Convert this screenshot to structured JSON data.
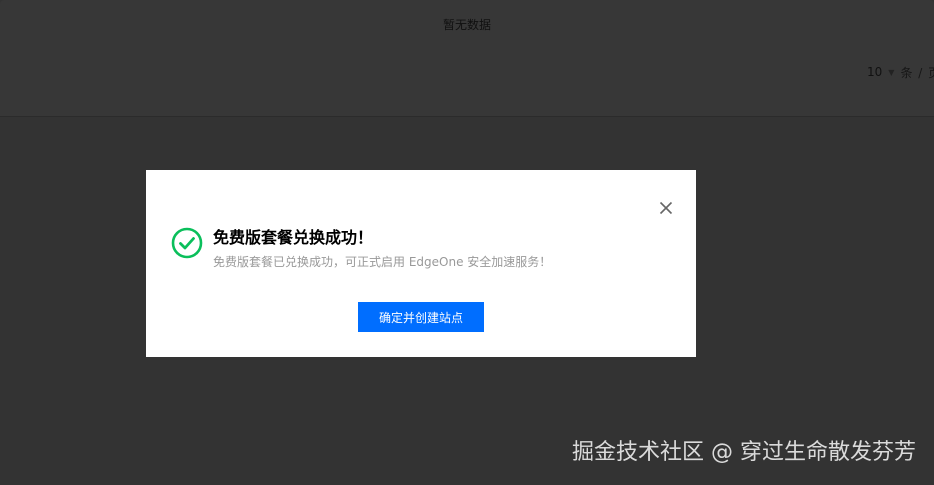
{
  "background": {
    "empty_text": "暂无数据",
    "pager": {
      "page_size": "10",
      "unit": "条 / 页"
    }
  },
  "modal": {
    "title": "免费版套餐兑换成功！",
    "description": "免费版套餐已兑换成功，可正式启用 EdgeOne 安全加速服务！",
    "confirm_label": "确定并创建站点",
    "close_icon": "close-icon",
    "status_icon": "check-circle-icon"
  },
  "watermark": "掘金技术社区 @ 穿过生命散发芬芳",
  "colors": {
    "overlay": "#333333",
    "primary": "#006eff",
    "success": "#0abf5b",
    "description": "#999999"
  }
}
